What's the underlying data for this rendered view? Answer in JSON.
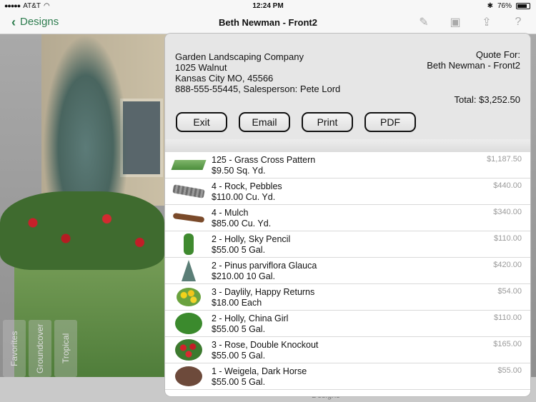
{
  "status_bar": {
    "carrier": "AT&T",
    "time": "12:24 PM",
    "battery": "76%"
  },
  "nav": {
    "back_label": "Designs",
    "title": "Beth Newman - Front2"
  },
  "side_tabs": [
    "Favorites",
    "Groundcover",
    "Tropical"
  ],
  "bottom_text": "Designs",
  "quote": {
    "company_name": "Garden Landscaping Company",
    "company_address1": "1025 Walnut",
    "company_address2": "Kansas City MO, 45566",
    "company_contact": "888-555-55445, Salesperson: Pete Lord",
    "quote_for_label": "Quote For:",
    "quote_for_name": "Beth Newman - Front2",
    "total": "Total: $3,252.50",
    "buttons": {
      "exit": "Exit",
      "email": "Email",
      "print": "Print",
      "pdf": "PDF"
    },
    "items": [
      {
        "name": "125 - Grass Cross Pattern",
        "price": "$9.50 Sq. Yd.",
        "amount": "$1,187.50",
        "thumb": "grass"
      },
      {
        "name": "4 - Rock, Pebbles",
        "price": "$110.00 Cu. Yd.",
        "amount": "$440.00",
        "thumb": "rock"
      },
      {
        "name": "4 - Mulch",
        "price": "$85.00 Cu. Yd.",
        "amount": "$340.00",
        "thumb": "mulch"
      },
      {
        "name": "2 - Holly, Sky Pencil",
        "price": "$55.00 5 Gal.",
        "amount": "$110.00",
        "thumb": "holly-sky"
      },
      {
        "name": "2 - Pinus parviflora Glauca",
        "price": "$210.00 10 Gal.",
        "amount": "$420.00",
        "thumb": "pine"
      },
      {
        "name": "3 - Daylily,  Happy Returns",
        "price": "$18.00 Each",
        "amount": "$54.00",
        "thumb": "daylily"
      },
      {
        "name": "2 - Holly, China Girl",
        "price": "$55.00 5 Gal.",
        "amount": "$110.00",
        "thumb": "holly-china"
      },
      {
        "name": "3 - Rose, Double Knockout",
        "price": "$55.00 5 Gal.",
        "amount": "$165.00",
        "thumb": "rose"
      },
      {
        "name": "1 - Weigela, Dark Horse",
        "price": "$55.00 5 Gal.",
        "amount": "$55.00",
        "thumb": "weigela"
      }
    ]
  }
}
